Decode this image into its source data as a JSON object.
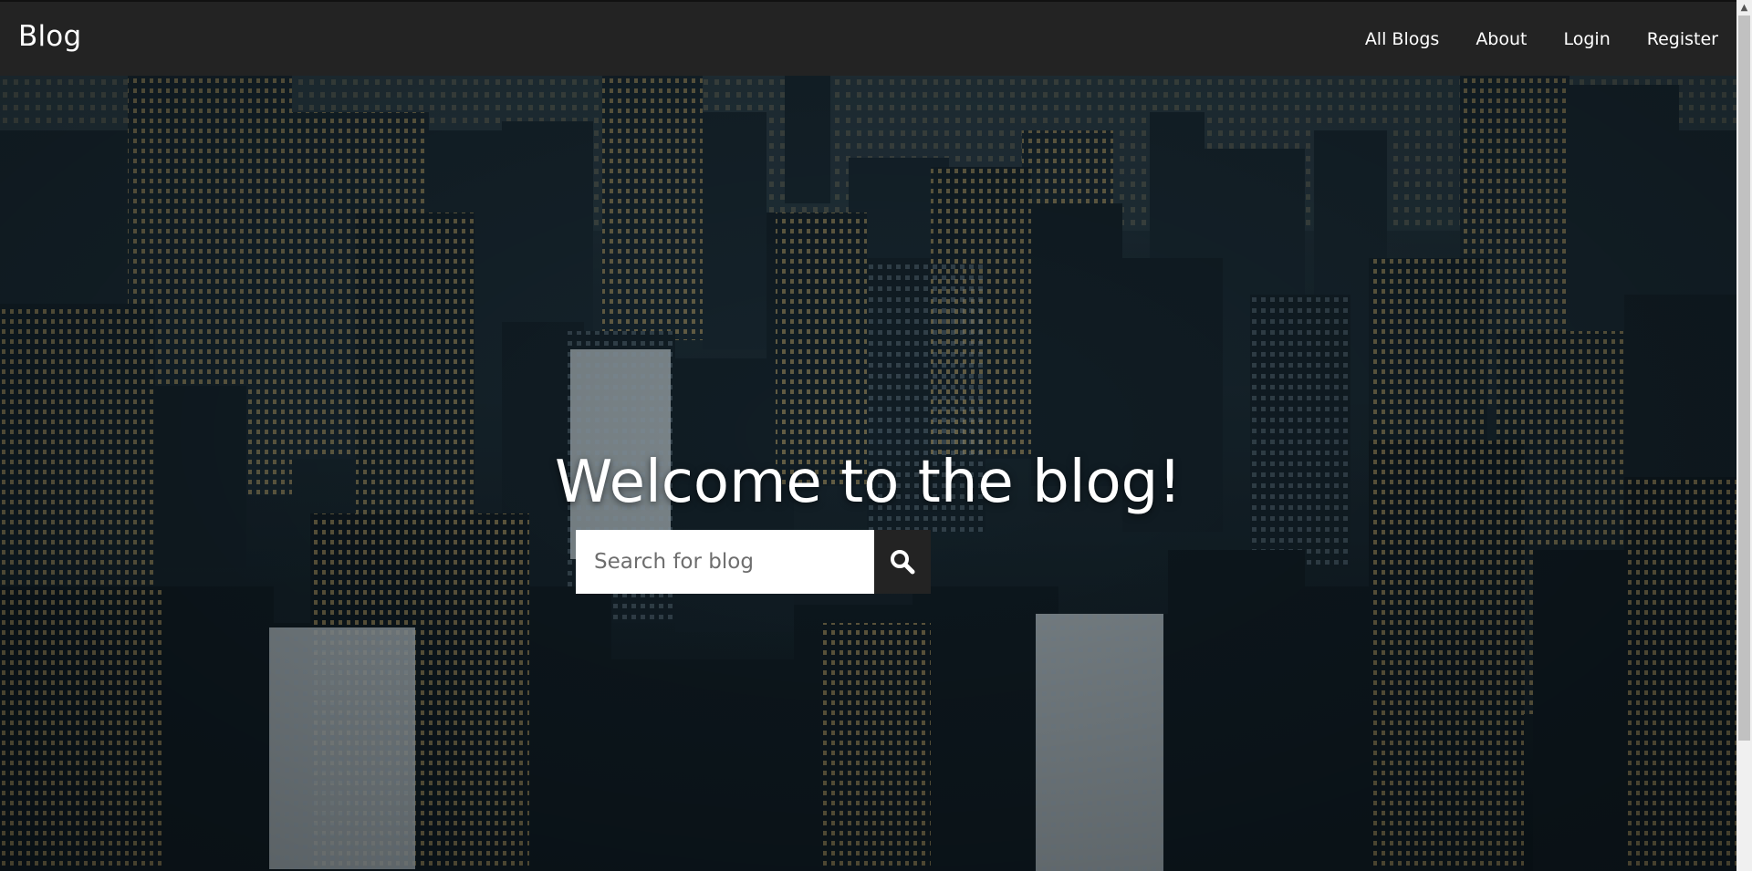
{
  "navbar": {
    "brand": "Blog",
    "links": [
      {
        "label": "All Blogs"
      },
      {
        "label": "About"
      },
      {
        "label": "Login"
      },
      {
        "label": "Register"
      }
    ]
  },
  "hero": {
    "title": "Welcome to the blog!",
    "search": {
      "placeholder": "Search for blog",
      "value": "",
      "button_icon": "search-icon"
    }
  },
  "colors": {
    "navbar_bg": "#232323",
    "text": "#ffffff",
    "search_button_bg": "#232323"
  }
}
